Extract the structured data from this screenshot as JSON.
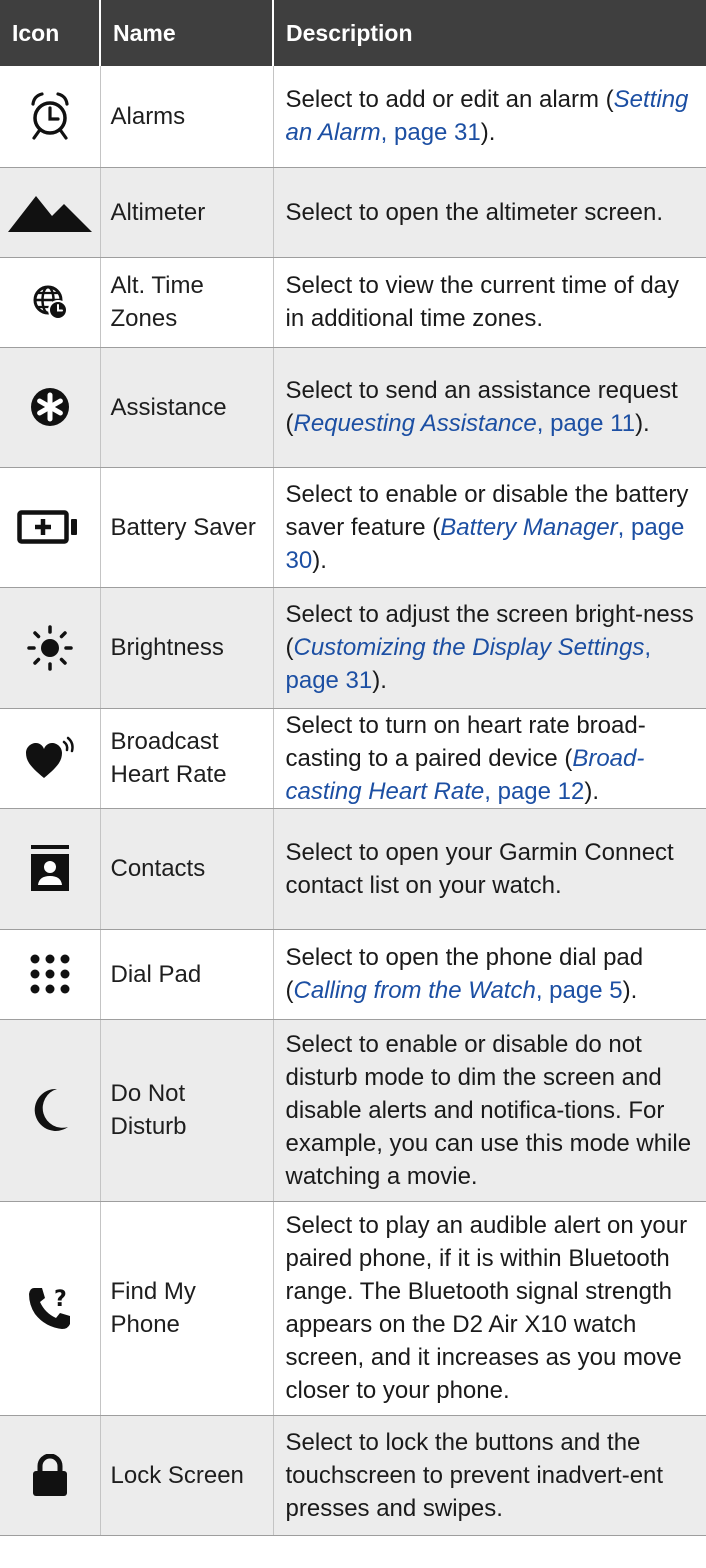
{
  "header": {
    "icon": "Icon",
    "name": "Name",
    "description": "Description"
  },
  "rows": [
    {
      "icon": "alarm-clock-icon",
      "name": "Alarms",
      "desc_pre": "Select to add or edit an alarm (",
      "link_title": "Setting an Alarm",
      "link_page": ", page 31",
      "desc_post": ")."
    },
    {
      "icon": "mountain-icon",
      "name": "Altimeter",
      "desc": "Select to open the altimeter screen."
    },
    {
      "icon": "globe-clock-icon",
      "name": "Alt. Time Zones",
      "desc": "Select to view the current time of day in additional time zones."
    },
    {
      "icon": "asterisk-circle-icon",
      "name": "Assistance",
      "desc_pre": "Select to send an assistance request (",
      "link_title": "Requesting Assistance",
      "link_page": ", page 11",
      "desc_post": ")."
    },
    {
      "icon": "battery-plus-icon",
      "name": "Battery Saver",
      "desc_pre": "Select to enable or disable the battery saver feature (",
      "link_title": "Battery Manager",
      "link_page": ", page 30",
      "desc_post": ")."
    },
    {
      "icon": "sun-icon",
      "name": "Brightness",
      "desc_pre": "Select to adjust the screen bright-ness (",
      "link_title": "Customizing the Display Settings",
      "link_page": ", page 31",
      "desc_post": ")."
    },
    {
      "icon": "heart-broadcast-icon",
      "name": "Broadcast Heart Rate",
      "desc_pre": "Select to turn on heart rate broad-casting to a paired device (",
      "link_title": "Broad-casting Heart Rate",
      "link_page": ", page 12",
      "desc_post": ")."
    },
    {
      "icon": "contact-card-icon",
      "name": "Contacts",
      "desc": "Select to open your Garmin Connect contact list on your watch."
    },
    {
      "icon": "dial-pad-icon",
      "name": "Dial Pad",
      "desc_pre": "Select to open the phone dial pad (",
      "link_title": "Calling from the Watch",
      "link_page": ", page 5",
      "desc_post": ")."
    },
    {
      "icon": "moon-icon",
      "name": "Do Not Disturb",
      "desc": "Select to enable or disable do not disturb mode to dim the screen and disable alerts and notifica-tions. For example, you can use this mode while watching a movie."
    },
    {
      "icon": "phone-question-icon",
      "name": "Find My Phone",
      "desc": "Select to play an audible alert on your paired phone, if it is within Bluetooth range. The Bluetooth signal strength appears on the D2 Air X10 watch screen, and it increases as you move closer to your phone."
    },
    {
      "icon": "padlock-icon",
      "name": "Lock Screen",
      "desc": "Select to lock the buttons and the touchscreen to prevent inadvert-ent presses and swipes."
    }
  ]
}
